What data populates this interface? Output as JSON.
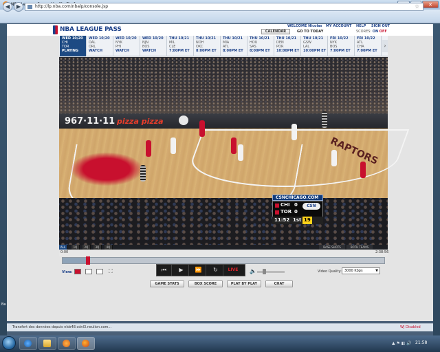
{
  "window": {
    "title": "NBA League Pass - Mozilla Firefox",
    "url": "http://lp.nba.com/nbalp/console.jsp",
    "controls": [
      "minimize-icon",
      "maximize-icon",
      "close-icon"
    ]
  },
  "header": {
    "brand": "NBA LEAGUE PASS",
    "links": [
      "WELCOME Nicolas",
      "MY ACCOUNT",
      "HELP",
      "SIGN OUT"
    ],
    "calendar_label": "CALENDAR",
    "today_label": "GO TO TODAY",
    "scores_label": "SCORES:",
    "scores_on": "ON",
    "scores_off": "OFF"
  },
  "schedule": [
    {
      "date": "WED 10/20",
      "line1": "CHI",
      "line2": "TOR",
      "status": "PLAYING",
      "active": true
    },
    {
      "date": "WED 10/20",
      "line1": "DAL",
      "line2": "ORL",
      "status": "WATCH"
    },
    {
      "date": "WED 10/20",
      "line1": "NYK",
      "line2": "PHI",
      "status": "WATCH"
    },
    {
      "date": "WED 10/20",
      "line1": "NJN",
      "line2": "BOS",
      "status": "WATCH"
    },
    {
      "date": "THU 10/21",
      "line1": "MIL",
      "line2": "CLE",
      "status": "7:00PM ET"
    },
    {
      "date": "THU 10/21",
      "line1": "NOH",
      "line2": "OKC",
      "status": "8:00PM ET"
    },
    {
      "date": "THU 10/21",
      "line1": "MIA",
      "line2": "ATL",
      "status": "8:00PM ET"
    },
    {
      "date": "THU 10/21",
      "line1": "HOU",
      "line2": "SAS",
      "status": "8:00PM ET"
    },
    {
      "date": "THU 10/21",
      "line1": "DEN",
      "line2": "POR",
      "status": "10:00PM ET"
    },
    {
      "date": "THU 10/21",
      "line1": "GSW",
      "line2": "LAL",
      "status": "10:00PM ET"
    },
    {
      "date": "FRI 10/22",
      "line1": "NYK",
      "line2": "BOS",
      "status": "7:00PM ET"
    },
    {
      "date": "FRI 10/22",
      "line1": "ATL",
      "line2": "CHA",
      "status": "7:00PM ET"
    }
  ],
  "video": {
    "ad_board_1": "967·11·11",
    "ad_board_2": "pizza pizza",
    "floor_text": "RAPTORS",
    "scorebug": {
      "network": "CSNCHICAGO.COM",
      "team1": "CHI",
      "score1": "0",
      "team2": "TOR",
      "score2": "0",
      "network_logo": "CSN",
      "clock": "11:52",
      "period": "1st",
      "shot_clock": "19",
      "team1_color": "#c8102e",
      "team2_color": "#c8102e"
    }
  },
  "view_tabs": [
    "ALL",
    "1Q",
    "2Q",
    "3Q",
    "4Q"
  ],
  "right_links": [
    "BASE SHOTS",
    "BOTH TEAMS"
  ],
  "timeline": {
    "start": "0:00",
    "end": "2:38:56",
    "progress": 0.08
  },
  "controls": {
    "view_label": "View:",
    "live_label": "LIVE",
    "video_quality_label": "Video Quality:",
    "video_quality_value": "3000 Kbps",
    "volume": 0.25
  },
  "bottom_buttons": [
    "GAME STATS",
    "BOX SCORE",
    "PLAY BY PLAY",
    "CHAT"
  ],
  "status": {
    "text": "Transfert des données depuis nlds48.cdnl3.neulion.com...",
    "right": "WJ Disabled"
  },
  "taskbar": {
    "clock": "21:58",
    "desktop_label": "Ba"
  },
  "colors": {
    "nba_blue": "#1d428a",
    "nba_red": "#c8102e",
    "active_game": "#1d4a83"
  }
}
